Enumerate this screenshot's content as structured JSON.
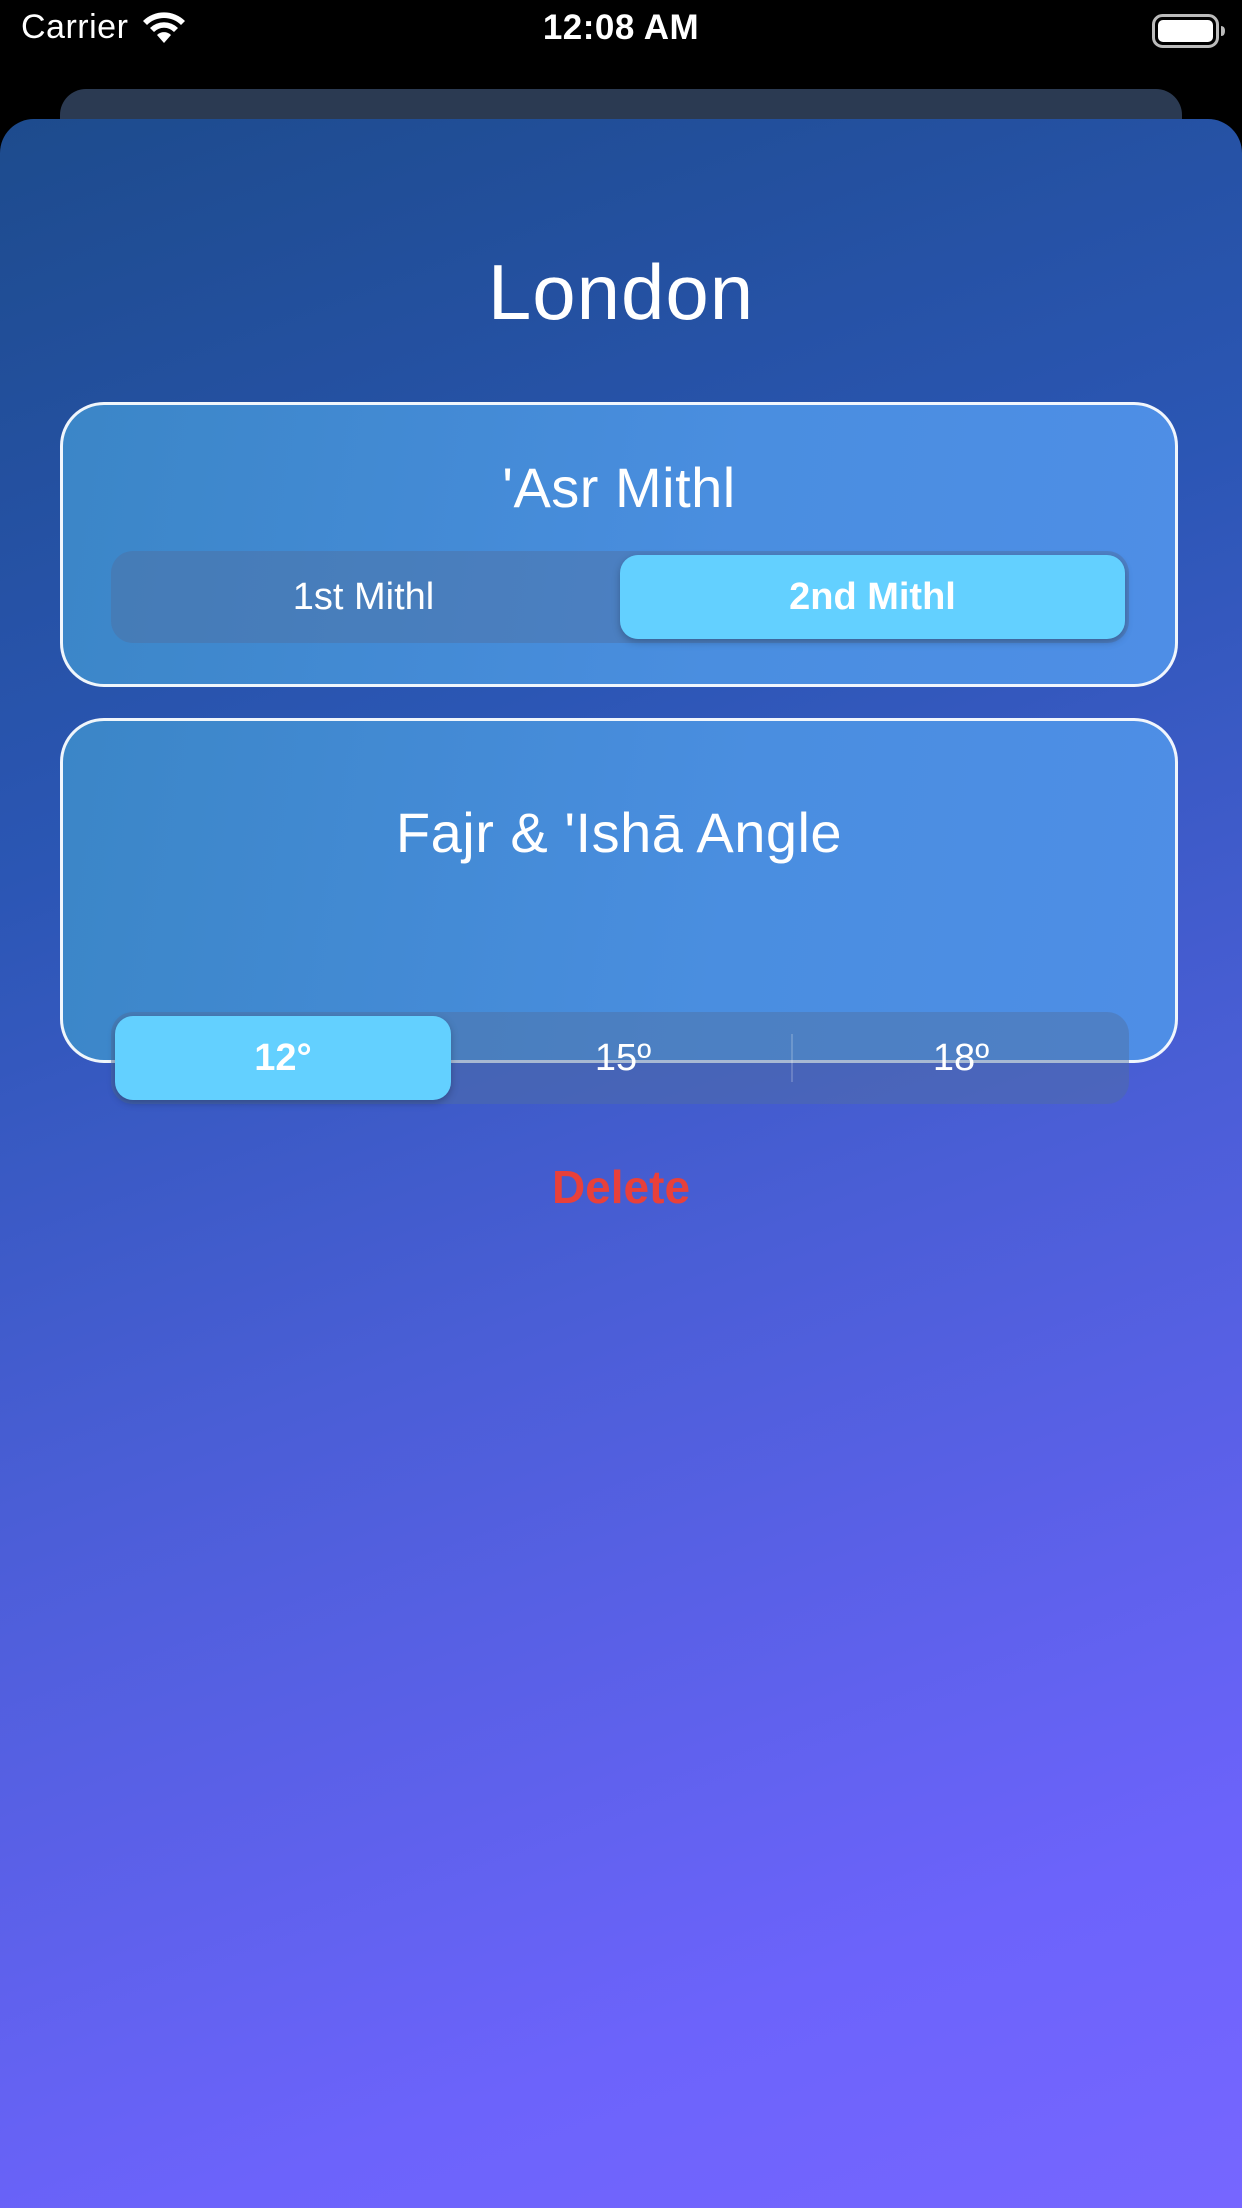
{
  "status_bar": {
    "carrier": "Carrier",
    "time": "12:08 AM"
  },
  "city": {
    "name": "London"
  },
  "asr_card": {
    "title": "'Asr Mithl",
    "options": [
      "1st Mithl",
      "2nd Mithl"
    ],
    "selected": "2nd Mithl"
  },
  "fajr_card": {
    "title": "Fajr & 'Ishā Angle",
    "options": [
      "12°",
      "15º",
      "18º"
    ],
    "selected": "12°"
  },
  "actions": {
    "delete_label": "Delete"
  },
  "colors": {
    "accent_selected": "#63d0ff",
    "delete": "#e8403a",
    "gradient_top": "#1d4b8d",
    "gradient_bottom": "#7666ff"
  },
  "icons": [
    "wifi-icon",
    "battery-icon"
  ]
}
